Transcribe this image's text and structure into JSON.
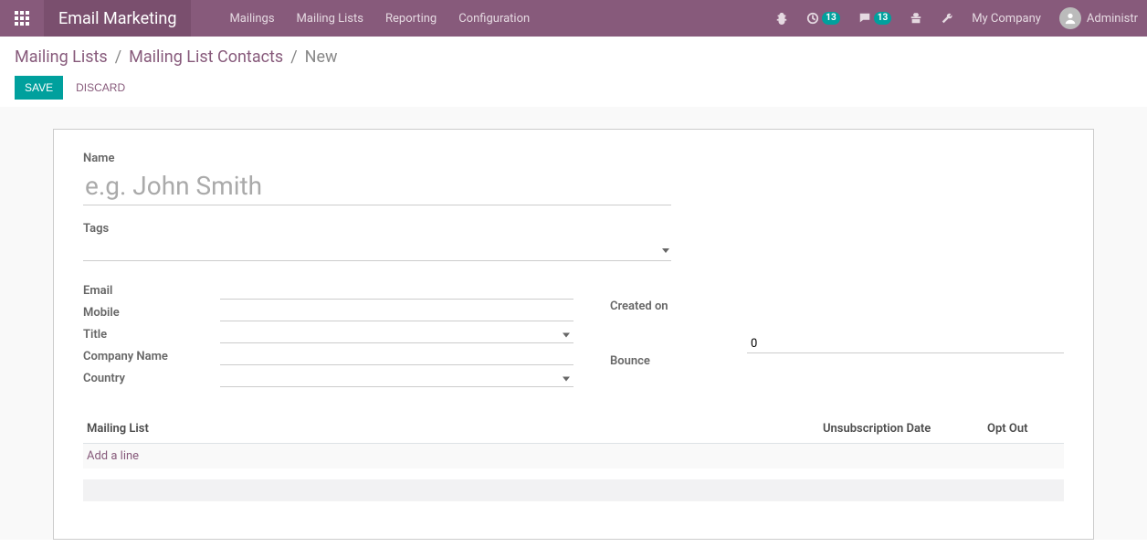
{
  "navbar": {
    "brand": "Email Marketing",
    "menu": [
      {
        "label": "Mailings"
      },
      {
        "label": "Mailing Lists"
      },
      {
        "label": "Reporting"
      },
      {
        "label": "Configuration"
      }
    ],
    "activity_count": "13",
    "discuss_count": "13",
    "company": "My Company",
    "user": "Administr"
  },
  "breadcrumb": {
    "root": "Mailing Lists",
    "mid": "Mailing List Contacts",
    "current": "New"
  },
  "buttons": {
    "save": "SAVE",
    "discard": "DISCARD"
  },
  "form": {
    "name_label": "Name",
    "name_placeholder": "e.g. John Smith",
    "name_value": "",
    "tags_label": "Tags",
    "left": {
      "email_label": "Email",
      "email_value": "",
      "mobile_label": "Mobile",
      "mobile_value": "",
      "title_label": "Title",
      "title_value": "",
      "company_label": "Company Name",
      "company_value": "",
      "country_label": "Country",
      "country_value": ""
    },
    "right": {
      "created_label": "Created on",
      "created_value": "",
      "bounce_label": "Bounce",
      "bounce_value": "0"
    },
    "list": {
      "col_mailing_list": "Mailing List",
      "col_unsub_date": "Unsubscription Date",
      "col_opt_out": "Opt Out",
      "add_line": "Add a line"
    }
  }
}
